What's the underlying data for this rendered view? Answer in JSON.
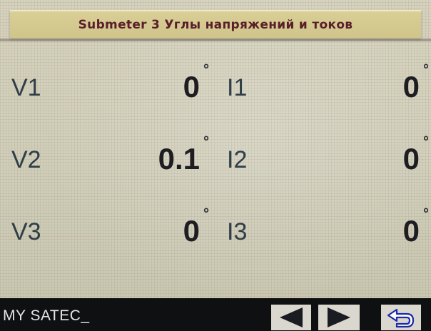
{
  "header": {
    "title": "Submeter 3 Углы напряжений и токов"
  },
  "units": {
    "degree_symbol": "°"
  },
  "rows": [
    {
      "voltage_label": "V1",
      "voltage_value": "0",
      "current_label": "I1",
      "current_value": "0"
    },
    {
      "voltage_label": "V2",
      "voltage_value": "0.1",
      "current_label": "I2",
      "current_value": "0"
    },
    {
      "voltage_label": "V3",
      "voltage_value": "0",
      "current_label": "I3",
      "current_value": "0"
    }
  ],
  "footer": {
    "brand": "MY SATEC_"
  },
  "icons": {
    "previous": "arrow-left-icon",
    "next": "arrow-right-icon",
    "return": "return-icon"
  },
  "colors": {
    "screen_background": "#d2cfba",
    "title_background": "#d6cc91",
    "title_text": "#5a1f2a",
    "value_text": "#1d1d22",
    "label_text": "#2f3e47",
    "bottom_bar": "#0f1012"
  }
}
